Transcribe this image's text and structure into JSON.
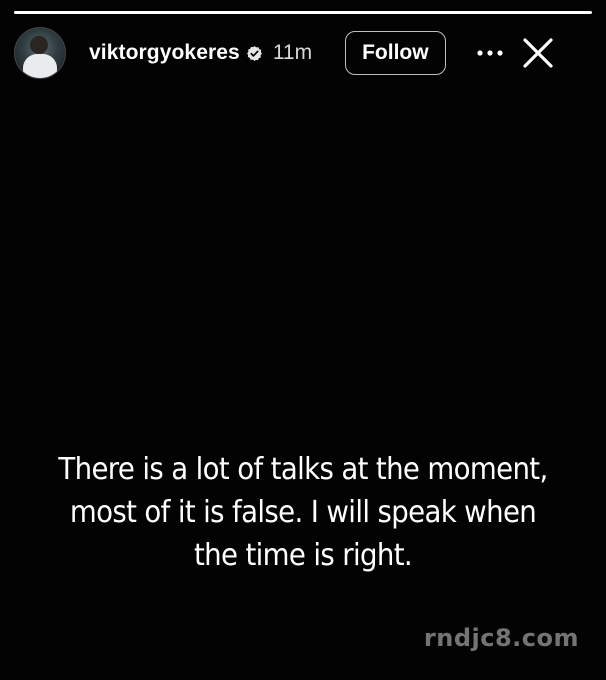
{
  "story": {
    "progress": 1.0,
    "username": "viktorgyokeres",
    "verified": true,
    "time_ago": "11m",
    "follow_label": "Follow",
    "more_icon": "more-horizontal-icon",
    "close_icon": "close-icon",
    "caption_lines": [
      "There is a lot of talks at the moment,",
      "most of it is false. I will speak when",
      "the time is right."
    ]
  },
  "watermark": "rndjc8.com",
  "colors": {
    "background": "#030303",
    "text": "#ffffff",
    "button_border": "#bfbfbf"
  }
}
